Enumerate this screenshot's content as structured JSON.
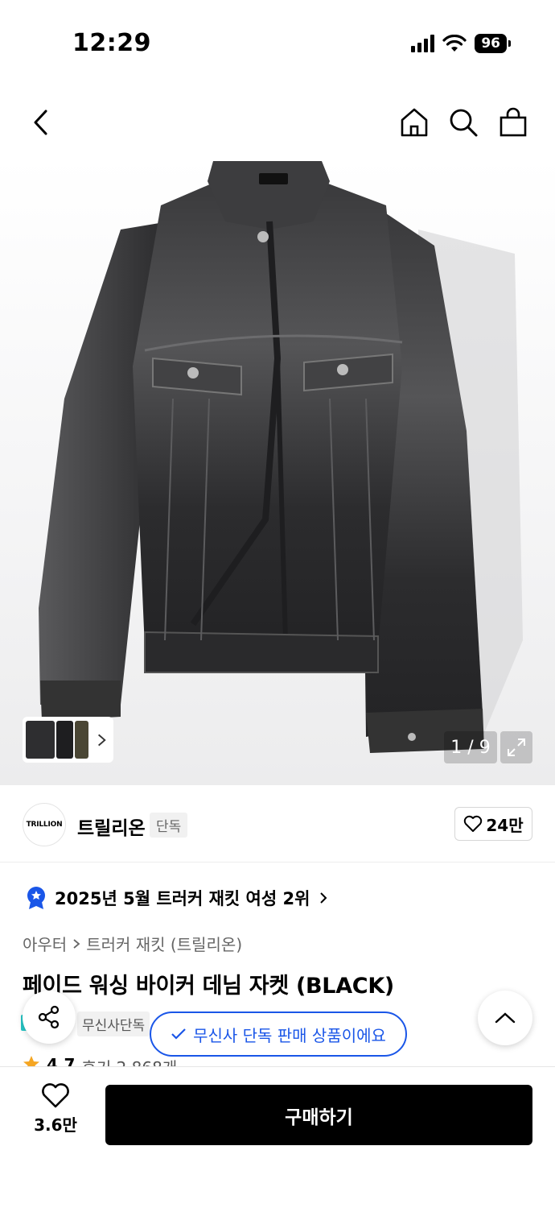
{
  "status_bar": {
    "time": "12:29",
    "battery": "96"
  },
  "nav": {
    "icons": [
      "back-icon",
      "home-icon",
      "search-icon",
      "bag-icon"
    ]
  },
  "gallery": {
    "page_indicator": "1 / 9",
    "thumbnails": 3,
    "colors": {
      "jacket": "#2e2e30"
    }
  },
  "brand": {
    "logo_text": "TRILLION",
    "name": "트릴리온",
    "badge": "단독",
    "likes": "24만"
  },
  "ranking": {
    "text": "2025년 5월 트러커 재킷 여성 2위"
  },
  "breadcrumb": {
    "level1": "아우터",
    "level2": "트러커 재킷 (트릴리온)"
  },
  "product": {
    "title": "페이드 워싱 바이커 데님 자켓 (BLACK)"
  },
  "tags": {
    "exclusive": "무신사단독"
  },
  "toast": {
    "text": "무신사 단독 판매 상품이에요",
    "color": "#1a56e8"
  },
  "rating": {
    "score": "4.7",
    "reviews": "후기 2,868개"
  },
  "bottom_bar": {
    "like_count": "3.6만",
    "buy_label": "구매하기"
  }
}
